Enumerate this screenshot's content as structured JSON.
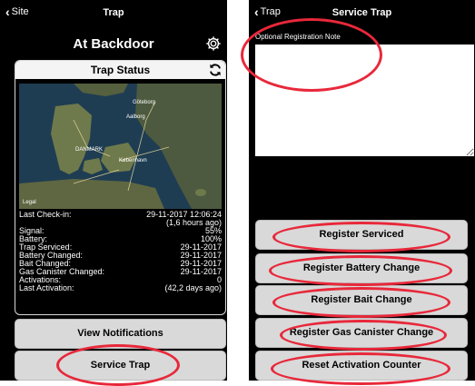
{
  "left_screen": {
    "nav": {
      "back_label": "Site",
      "title": "Trap"
    },
    "page_title": "At Backdoor",
    "status_card": {
      "title": "Trap Status",
      "map_labels": [
        "Göteborg",
        "Aalborg",
        "DANMARK",
        "København",
        "Legal"
      ],
      "rows": [
        {
          "label": "Last Check-in:",
          "value": "29-11-2017 12:06:24"
        },
        {
          "label": "",
          "value": "(1,6 hours ago)"
        },
        {
          "label": "Signal:",
          "value": "55%"
        },
        {
          "label": "Battery:",
          "value": "100%"
        },
        {
          "label": "Trap Serviced:",
          "value": "29-11-2017"
        },
        {
          "label": "Battery Changed:",
          "value": "29-11-2017"
        },
        {
          "label": "Bait Changed:",
          "value": "29-11-2017"
        },
        {
          "label": "Gas Canister Changed:",
          "value": "29-11-2017"
        },
        {
          "label": "Activations:",
          "value": "0"
        },
        {
          "label": "Last Activation:",
          "value": "(42,2 days ago)"
        }
      ]
    },
    "buttons": {
      "view_notifications": "View Notifications",
      "service_trap": "Service Trap"
    }
  },
  "right_screen": {
    "nav": {
      "back_label": "Trap",
      "title": "Service Trap"
    },
    "note_label": "Optional Registration Note",
    "note_value": "",
    "buttons": {
      "register_serviced": "Register Serviced",
      "register_battery": "Register Battery Change",
      "register_bait": "Register Bait Change",
      "register_gas": "Register Gas Canister Change",
      "reset_counter": "Reset Activation Counter"
    }
  },
  "colors": {
    "annotation_red": "#e8283a",
    "button_gray": "#d9d9d9",
    "background": "#000000"
  },
  "icons": {
    "back": "chevron-left-icon",
    "settings": "gear-icon",
    "refresh": "refresh-icon"
  }
}
